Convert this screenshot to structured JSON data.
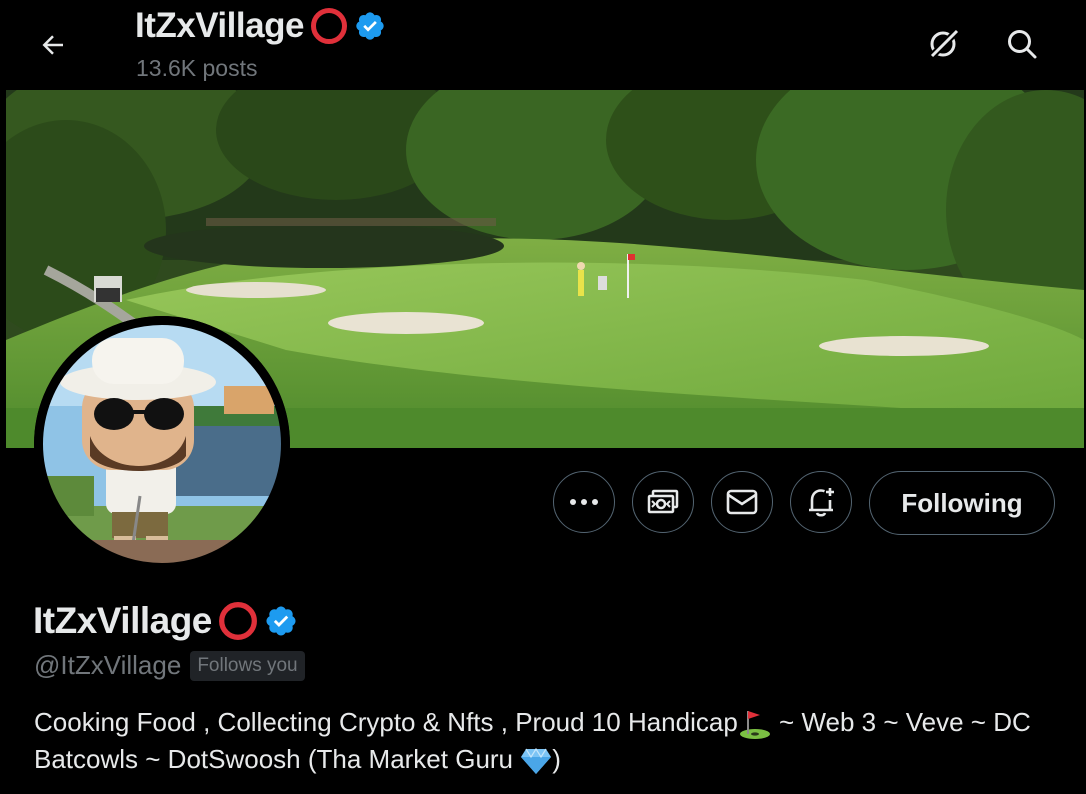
{
  "header": {
    "display_name": "ItZxVillage",
    "post_count": "13.6K posts"
  },
  "icons": {
    "back": "arrow-left-icon",
    "grok": "grok-icon",
    "search": "search-icon",
    "verified": "verified-badge-icon",
    "name_emoji": "red-circle-icon",
    "more": "more-dots-icon",
    "subscribe": "money-icon",
    "message": "mail-icon",
    "notify": "bell-plus-icon",
    "bio_emoji_1": "flag-in-hole-icon",
    "bio_emoji_2": "gem-icon"
  },
  "profile": {
    "display_name": "ItZxVillage",
    "handle": "@ItZxVillage",
    "follows_you": "Follows you",
    "bio_part1": "Cooking Food , Collecting Crypto & Nfts , Proud 10 Handicap",
    "bio_part2": " ~ Web 3 ~ Veve ~ DC Batcowls ~ DotSwoosh (Tha Market Guru ",
    "bio_part3": ")"
  },
  "actions": {
    "following_label": "Following"
  },
  "colors": {
    "background": "#000000",
    "text_primary": "#e7e9ea",
    "text_secondary": "#71767b",
    "verified": "#1d9bf0",
    "border": "#536471"
  }
}
